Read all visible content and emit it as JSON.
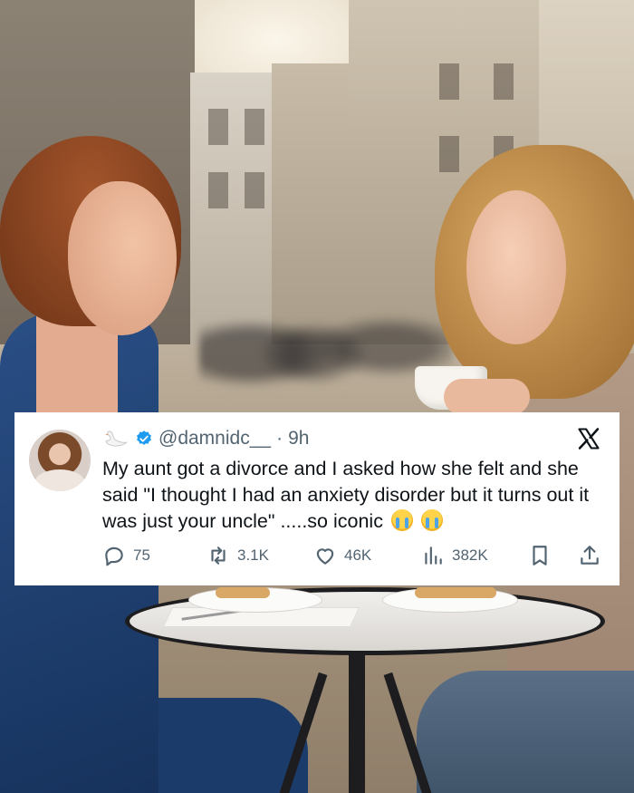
{
  "tweet": {
    "display_icon": "swan-emoji",
    "handle": "@damnidc__",
    "separator": "·",
    "time": "9h",
    "text": "My aunt got a divorce and I asked how she felt and she said \"I thought I had an anxiety disorder but it turns out it was just your uncle\" .....so iconic",
    "trailing_emojis": [
      "crying-face-emoji",
      "crying-face-emoji"
    ],
    "stats": {
      "replies": "75",
      "reposts": "3.1K",
      "likes": "46K",
      "views": "382K"
    },
    "verified_color": "#1d9bf0",
    "platform_icon": "x-logo-icon"
  },
  "colors": {
    "card_bg": "#ffffff",
    "text_primary": "#0f1419",
    "text_secondary": "#536471"
  }
}
